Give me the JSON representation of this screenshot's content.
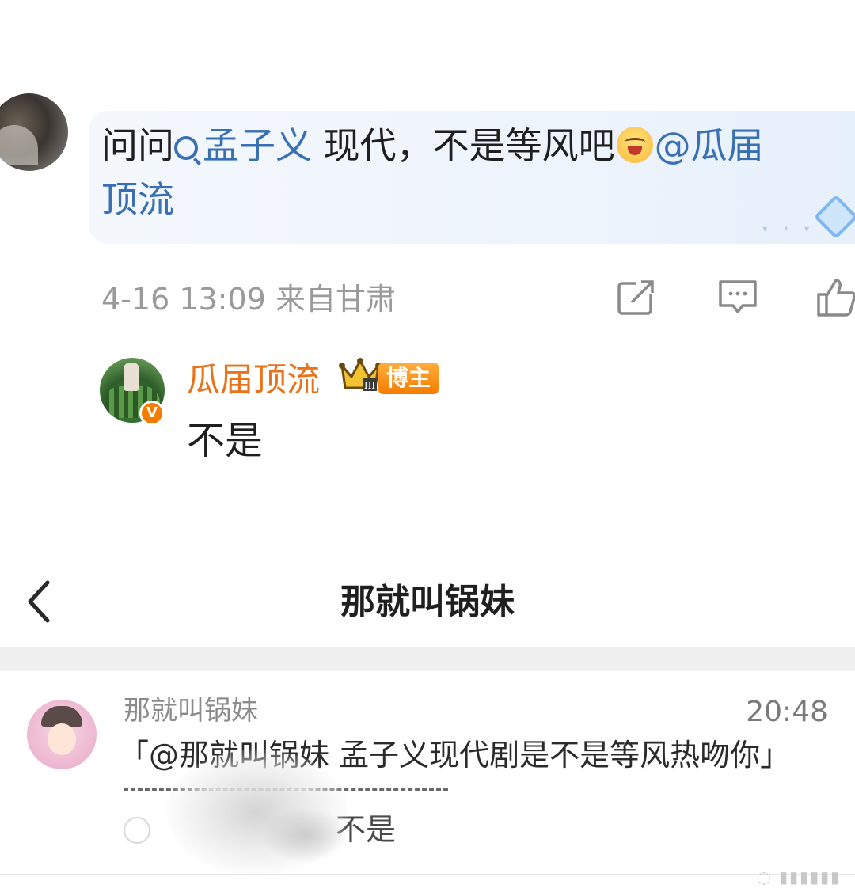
{
  "comment": {
    "prefix": "问问",
    "topic": "孟子义",
    "text_mid": " 现代，不是等风吧",
    "mention": "@瓜届",
    "text_line2": "顶流",
    "emoji": "laughing-crying-emoji"
  },
  "meta": {
    "datetime": "4-16 13:09",
    "location": "来自甘肃"
  },
  "actions": {
    "forward_icon": "share-icon",
    "comment_icon": "comment-icon",
    "like_icon": "like-icon"
  },
  "reply": {
    "name": "瓜届顶流",
    "badge": "博主",
    "verify_mark": "V",
    "text": "不是"
  },
  "chat": {
    "title": "那就叫锅妹",
    "sender": "那就叫锅妹",
    "time": "20:48",
    "quote": "「@那就叫锅妹 孟子义现代剧是不是等风热吻你」",
    "reply": "不是"
  },
  "colors": {
    "link_blue": "#3a6fb3",
    "name_orange": "#e8731a",
    "badge_orange": "#f57c00",
    "meta_gray": "#9a9a9a"
  }
}
